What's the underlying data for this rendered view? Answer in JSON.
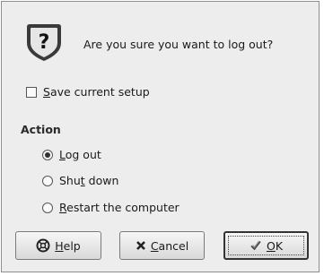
{
  "dialog": {
    "question": "Are you sure you want to log out?",
    "icon": "question-icon"
  },
  "save_setup": {
    "label": "Save current setup",
    "mnemonic": "S",
    "checked": false
  },
  "action": {
    "section_label": "Action",
    "options": [
      {
        "pre": "",
        "mnemonic": "L",
        "post": "og out",
        "selected": true
      },
      {
        "pre": "Shu",
        "mnemonic": "t",
        "post": " down",
        "selected": false
      },
      {
        "pre": "",
        "mnemonic": "R",
        "post": "estart the computer",
        "selected": false
      }
    ]
  },
  "buttons": {
    "help": {
      "pre": "",
      "mnemonic": "H",
      "post": "elp",
      "icon": "help-icon"
    },
    "cancel": {
      "pre": "",
      "mnemonic": "C",
      "post": "ancel",
      "icon": "cancel-icon"
    },
    "ok": {
      "pre": "",
      "mnemonic": "O",
      "post": "K",
      "icon": "checkmark-icon"
    }
  }
}
